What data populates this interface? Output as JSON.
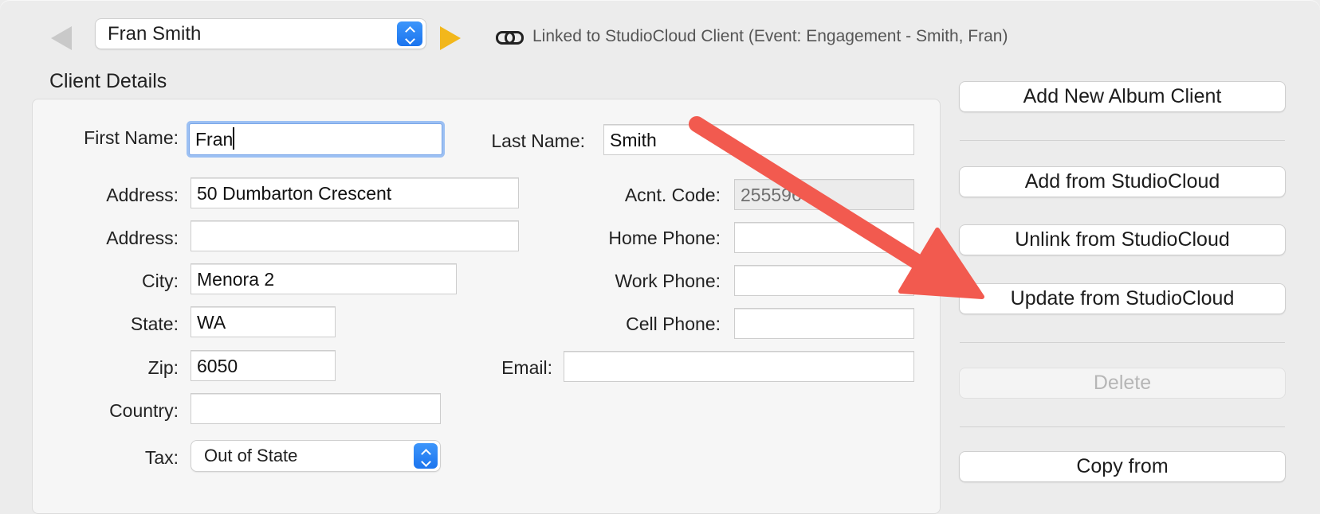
{
  "header": {
    "client_select": "Fran Smith",
    "link_status": "Linked to StudioCloud Client (Event: Engagement - Smith, Fran)"
  },
  "section_title": "Client Details",
  "form": {
    "first_name_label": "First Name:",
    "first_name_value": "Fran",
    "last_name_label": "Last Name:",
    "last_name_value": "Smith",
    "address1_label": "Address:",
    "address1_value": "50 Dumbarton Crescent",
    "address2_label": "Address:",
    "address2_value": "",
    "city_label": "City:",
    "city_value": "Menora 2",
    "state_label": "State:",
    "state_value": "WA",
    "zip_label": "Zip:",
    "zip_value": "6050",
    "country_label": "Country:",
    "country_value": "",
    "tax_label": "Tax:",
    "tax_value": "Out of State",
    "acct_code_label": "Acnt. Code:",
    "acct_code_value": "2555960",
    "home_phone_label": "Home Phone:",
    "home_phone_value": "",
    "work_phone_label": "Work Phone:",
    "work_phone_value": "",
    "cell_phone_label": "Cell Phone:",
    "cell_phone_value": "",
    "email_label": "Email:",
    "email_value": ""
  },
  "actions": {
    "add_new": "Add New Album Client",
    "add_from_cloud": "Add from StudioCloud",
    "unlink": "Unlink from StudioCloud",
    "update": "Update from StudioCloud",
    "delete": "Delete",
    "copy_from": "Copy from"
  },
  "colors": {
    "accent_blue": "#1b74ee",
    "next_arrow": "#f2b71b",
    "annotation_arrow": "#f25a4f"
  }
}
